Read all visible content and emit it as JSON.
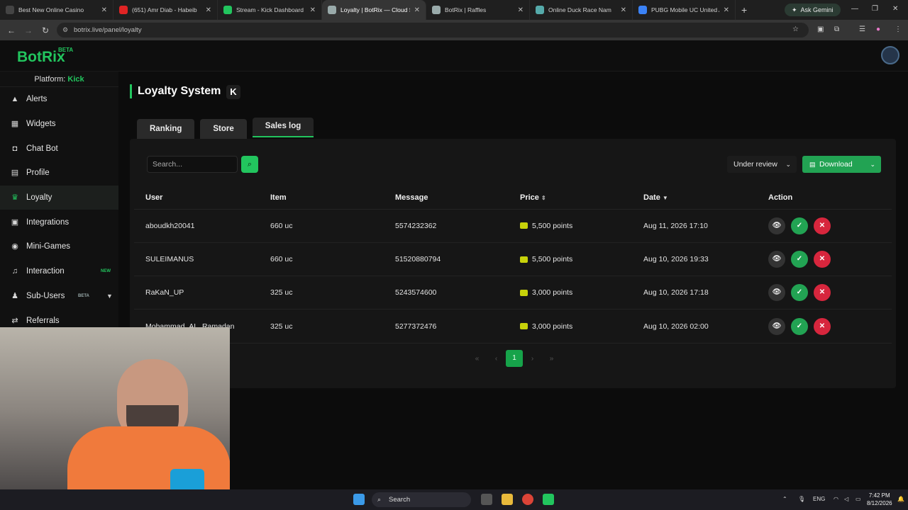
{
  "browser": {
    "tabs": [
      {
        "title": "Best New Online Casino",
        "color": "#444"
      },
      {
        "title": "(651) Amr Diab - Habeib",
        "color": "#e02424"
      },
      {
        "title": "Stream - Kick Dashboard",
        "color": "#22c55e"
      },
      {
        "title": "Loyalty | BotRix — Cloud St",
        "color": "#9aa",
        "active": true
      },
      {
        "title": "BotRix | Raffles",
        "color": "#9aa"
      },
      {
        "title": "Online Duck Race Nam",
        "color": "#5aa"
      },
      {
        "title": "PUBG Mobile UC United Ar",
        "color": "#3b82f6"
      }
    ],
    "gemini_label": "Ask Gemini",
    "url": "botrix.live/panel/loyalty"
  },
  "app": {
    "logo": "BotRix",
    "logo_badge": "BETA",
    "platform_label": "Platform:",
    "platform_value": "Kick"
  },
  "sidebar": {
    "items": [
      {
        "label": "Alerts",
        "icon": "warning-icon"
      },
      {
        "label": "Widgets",
        "icon": "widgets-icon"
      },
      {
        "label": "Chat Bot",
        "icon": "robot-icon"
      },
      {
        "label": "Profile",
        "icon": "profile-icon"
      },
      {
        "label": "Loyalty",
        "icon": "trophy-icon",
        "active": true
      },
      {
        "label": "Integrations",
        "icon": "integrations-icon"
      },
      {
        "label": "Mini-Games",
        "icon": "gamepad-icon"
      },
      {
        "label": "Interaction",
        "icon": "music-icon",
        "tag": "NEW"
      },
      {
        "label": "Sub-Users",
        "icon": "users-icon",
        "tag": "BETA"
      },
      {
        "label": "Referrals",
        "icon": "share-icon"
      }
    ]
  },
  "page": {
    "title": "Loyalty System",
    "platform_badge": "K",
    "tabs": [
      "Ranking",
      "Store",
      "Sales log"
    ],
    "active_tab": "Sales log"
  },
  "toolbar": {
    "search_placeholder": "Search...",
    "filter_value": "Under review",
    "download_label": "Download"
  },
  "table": {
    "columns": [
      "User",
      "Item",
      "Message",
      "Price",
      "Date",
      "Action"
    ],
    "rows": [
      {
        "user": "aboudkh20041",
        "item": "660 uc",
        "message": "5574232362",
        "price": "5,500 points",
        "date": "Aug 11, 2026 17:10"
      },
      {
        "user": "SULEIMANUS",
        "item": "660 uc",
        "message": "51520880794",
        "price": "5,500 points",
        "date": "Aug 10, 2026 19:33"
      },
      {
        "user": "RaKaN_UP",
        "item": "325 uc",
        "message": "5243574600",
        "price": "3,000 points",
        "date": "Aug 10, 2026 17:18"
      },
      {
        "user": "Mohammad_AL_Ramadan",
        "item": "325 uc",
        "message": "5277372476",
        "price": "3,000 points",
        "date": "Aug 10, 2026 02:00"
      }
    ]
  },
  "pagination": {
    "current": "1"
  },
  "taskbar": {
    "search_label": "Search",
    "lang": "ENG",
    "time": "7:42 PM",
    "date": "8/12/2026"
  },
  "colors": {
    "accent": "#22c55e",
    "danger": "#d7263d"
  }
}
